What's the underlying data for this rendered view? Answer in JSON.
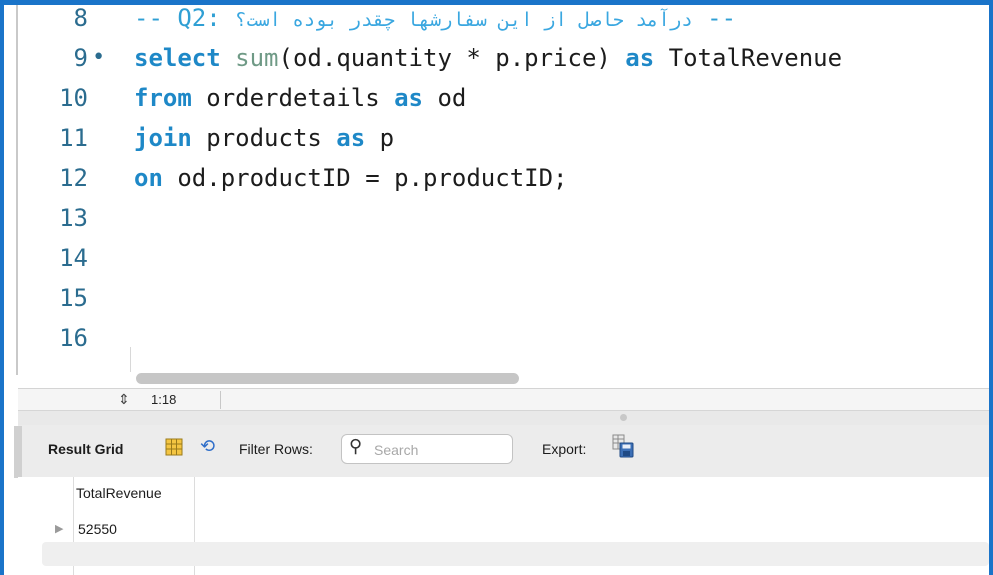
{
  "editor": {
    "lines": [
      {
        "number": "8",
        "marker": "",
        "parts": [
          {
            "t": "-- Q2: ",
            "c": "cm"
          },
          {
            "t": "درآمد حاصل از این سفارشها چقدر بوده است؟",
            "c": "cm-ar"
          },
          {
            "t": " --",
            "c": "cm"
          }
        ]
      },
      {
        "number": "9",
        "marker": "•",
        "parts": [
          {
            "t": "select",
            "c": "kw"
          },
          {
            "t": " ",
            "c": ""
          },
          {
            "t": "sum",
            "c": "fn"
          },
          {
            "t": "(od.quantity * p.price) ",
            "c": ""
          },
          {
            "t": "as",
            "c": "kw"
          },
          {
            "t": " TotalRevenue",
            "c": ""
          }
        ]
      },
      {
        "number": "10",
        "marker": "",
        "parts": [
          {
            "t": "from",
            "c": "kw"
          },
          {
            "t": " orderdetails ",
            "c": ""
          },
          {
            "t": "as",
            "c": "kw"
          },
          {
            "t": " od",
            "c": ""
          }
        ]
      },
      {
        "number": "11",
        "marker": "",
        "parts": [
          {
            "t": "join",
            "c": "kw"
          },
          {
            "t": " products ",
            "c": ""
          },
          {
            "t": "as",
            "c": "kw"
          },
          {
            "t": " p",
            "c": ""
          }
        ]
      },
      {
        "number": "12",
        "marker": "",
        "parts": [
          {
            "t": "on",
            "c": "kw"
          },
          {
            "t": " od.productID = p.productID;",
            "c": ""
          }
        ]
      },
      {
        "number": "13",
        "marker": "",
        "parts": []
      },
      {
        "number": "14",
        "marker": "",
        "parts": []
      },
      {
        "number": "15",
        "marker": "",
        "parts": []
      },
      {
        "number": "16",
        "marker": "",
        "parts": []
      }
    ]
  },
  "status": {
    "stepper": "⇕",
    "cursor_position": "1:18"
  },
  "result_toolbar": {
    "title": "Result Grid",
    "filter_label": "Filter Rows:",
    "search_placeholder": "Search",
    "export_label": "Export:"
  },
  "result_grid": {
    "columns": [
      "TotalRevenue"
    ],
    "rows": [
      [
        "52550"
      ]
    ]
  },
  "colors": {
    "frame_accent": "#1a74c9",
    "keyword": "#1e88c7",
    "function": "#6f9a86",
    "comment": "#2f9fd4",
    "line_number": "#2b6c8f"
  }
}
